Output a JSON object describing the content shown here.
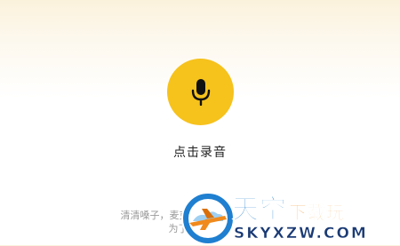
{
  "recorder": {
    "button_icon": "microphone-icon",
    "label": "点击录音",
    "tip_line1": "清清嗓子，麦克风距",
    "tip_line2": "为了准确性"
  },
  "watermark": {
    "title_large": "天空",
    "title_small": "下载玩",
    "domain": "SKYXZW.COM"
  },
  "colors": {
    "accent": "#f6c21c",
    "text_primary": "#222222",
    "text_secondary": "#9a9a9a",
    "watermark_blue": "#1f7fd0",
    "watermark_orange": "#f08a1c"
  }
}
